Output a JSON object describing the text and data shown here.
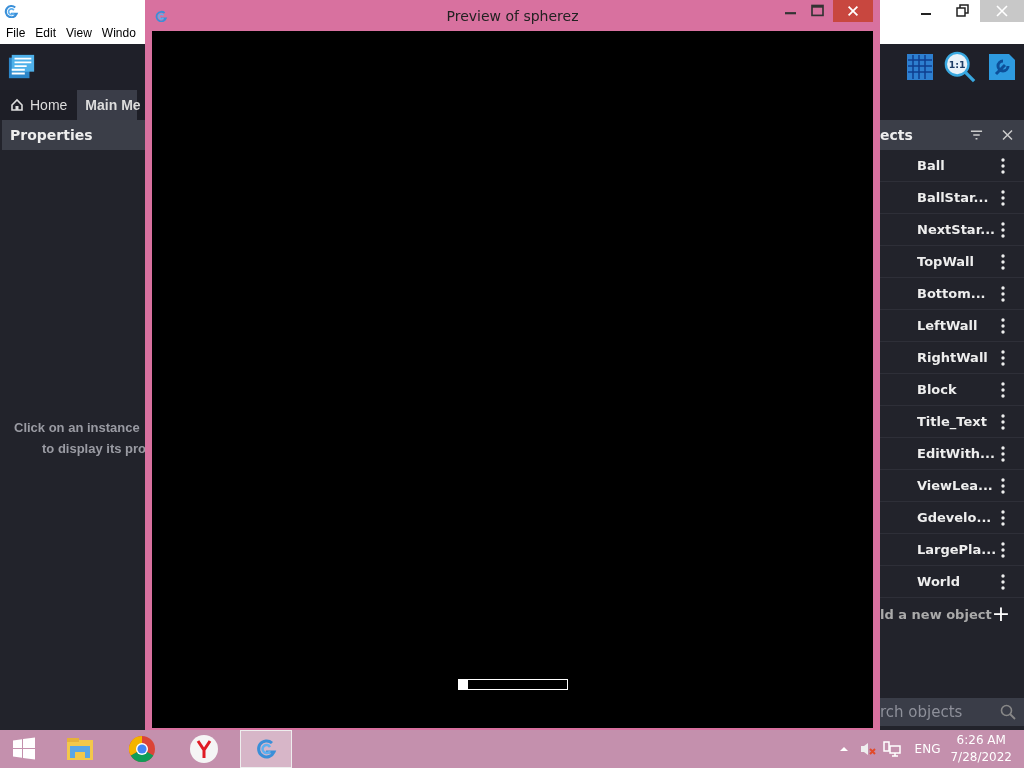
{
  "app": {
    "menu": [
      "File",
      "Edit",
      "View",
      "Windo"
    ],
    "toolbar": {
      "zoom_label": "1:1"
    },
    "tabs": [
      {
        "label": "Home",
        "selected": false
      },
      {
        "label": "Main Me",
        "selected": true
      }
    ],
    "properties": {
      "title": "Properties",
      "hint_lines": [
        "Click on an instance",
        "to display its pro"
      ]
    },
    "objects": {
      "title": "ects",
      "items": [
        "Ball",
        "BallStar...",
        "NextStar...",
        "TopWall",
        "Bottom...",
        "LeftWall",
        "RightWall",
        "Block",
        "Title_Text",
        "EditWith...",
        "ViewLea...",
        "Gdevelo...",
        "LargePla...",
        "World"
      ],
      "add_label": "ld a new object",
      "add_icon": "+",
      "search_placeholder": "rch objects"
    }
  },
  "preview": {
    "title": "Preview of spherez",
    "loading": {
      "level": 0.09
    }
  },
  "taskbar": {
    "apps": [
      {
        "kind": "explorer",
        "selected": false
      },
      {
        "kind": "chrome",
        "selected": false
      },
      {
        "kind": "yandex",
        "selected": false
      },
      {
        "kind": "gdevelop",
        "selected": true
      }
    ],
    "tray": {
      "muted": true,
      "language": "ENG",
      "time": "6:26 AM",
      "date": "7/28/2022"
    }
  }
}
